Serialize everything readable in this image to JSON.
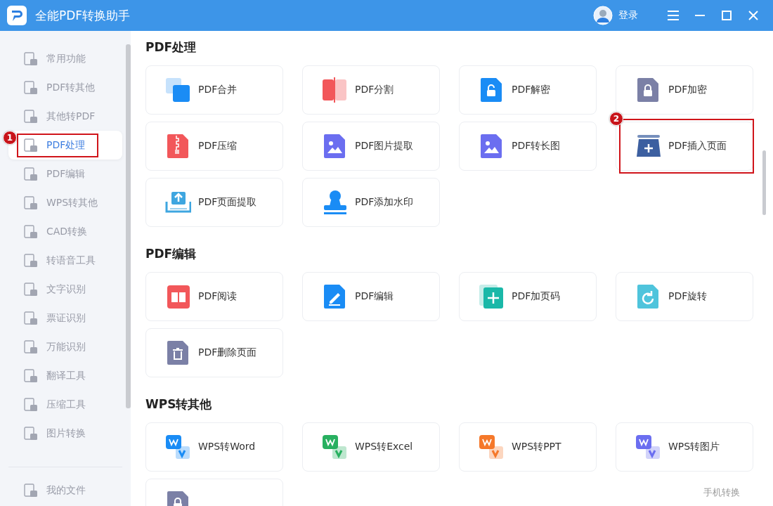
{
  "window": {
    "title": "全能PDF转换助手",
    "login": "登录"
  },
  "sidebar": {
    "items": [
      {
        "label": "常用功能",
        "selected": false
      },
      {
        "label": "PDF转其他",
        "selected": false
      },
      {
        "label": "其他转PDF",
        "selected": false
      },
      {
        "label": "PDF处理",
        "selected": true,
        "annotation": "1"
      },
      {
        "label": "PDF编辑",
        "selected": false
      },
      {
        "label": "WPS转其他",
        "selected": false
      },
      {
        "label": "CAD转换",
        "selected": false
      },
      {
        "label": "转语音工具",
        "selected": false
      },
      {
        "label": "文字识别",
        "selected": false
      },
      {
        "label": "票证识别",
        "selected": false
      },
      {
        "label": "万能识别",
        "selected": false
      },
      {
        "label": "翻译工具",
        "selected": false
      },
      {
        "label": "压缩工具",
        "selected": false
      },
      {
        "label": "图片转换",
        "selected": false
      }
    ],
    "footer": {
      "label": "我的文件"
    }
  },
  "sections": [
    {
      "title": "PDF处理",
      "cards": [
        {
          "label": "PDF合并",
          "kind": "merge",
          "color": "#1a8cf5"
        },
        {
          "label": "PDF分割",
          "kind": "split",
          "color": "#f2575a"
        },
        {
          "label": "PDF解密",
          "kind": "unlock",
          "color": "#1a8cf5"
        },
        {
          "label": "PDF加密",
          "kind": "lock",
          "color": "#7b80a6"
        },
        {
          "label": "PDF压缩",
          "kind": "zip",
          "color": "#f2575a"
        },
        {
          "label": "PDF图片提取",
          "kind": "image",
          "color": "#6b6ef0"
        },
        {
          "label": "PDF转长图",
          "kind": "image",
          "color": "#6b6ef0"
        },
        {
          "label": "PDF插入页面",
          "kind": "tray",
          "color": "#3c5fa0",
          "annotation": "2"
        },
        {
          "label": "PDF页面提取",
          "kind": "upload",
          "color": "#3ea6e0"
        },
        {
          "label": "PDF添加水印",
          "kind": "stamp",
          "color": "#1a8cf5"
        }
      ]
    },
    {
      "title": "PDF编辑",
      "cards": [
        {
          "label": "PDF阅读",
          "kind": "book",
          "color": "#f2575a"
        },
        {
          "label": "PDF编辑",
          "kind": "pen",
          "color": "#1a8cf5"
        },
        {
          "label": "PDF加页码",
          "kind": "plus",
          "color": "#1ab8a8"
        },
        {
          "label": "PDF旋转",
          "kind": "rotate",
          "color": "#4fc4dc"
        },
        {
          "label": "PDF删除页面",
          "kind": "trash",
          "color": "#7b80a6"
        }
      ]
    },
    {
      "title": "WPS转其他",
      "cards": [
        {
          "label": "WPS转Word",
          "kind": "wps",
          "color": "#1a8cf5"
        },
        {
          "label": "WPS转Excel",
          "kind": "wps",
          "color": "#28b060"
        },
        {
          "label": "WPS转PPT",
          "kind": "wps",
          "color": "#f5782a"
        },
        {
          "label": "WPS转图片",
          "kind": "wps",
          "color": "#6b6ef0"
        },
        {
          "kind": "lock",
          "color": "#7b80a6"
        }
      ]
    }
  ],
  "floating_link": "手机转换"
}
